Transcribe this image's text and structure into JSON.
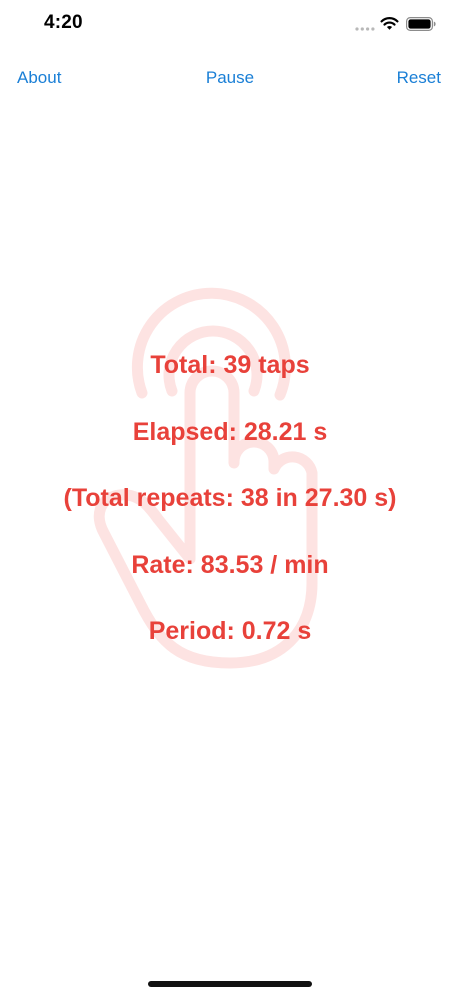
{
  "status_bar": {
    "time": "4:20",
    "icons": [
      "signal-icon",
      "wifi-icon",
      "battery-icon"
    ]
  },
  "nav": {
    "about_label": "About",
    "pause_label": "Pause",
    "reset_label": "Reset"
  },
  "stats": {
    "total": "Total: 39 taps",
    "elapsed": "Elapsed: 28.21 s",
    "repeats": "(Total repeats: 38 in 27.30 s)",
    "rate": "Rate: 83.53 / min",
    "period": "Period: 0.72 s"
  },
  "colors": {
    "accent": "#1a7fd6",
    "stat_text": "#e8413a",
    "hand_watermark": "#fde3e2"
  },
  "background_icon": "hand-tap-icon"
}
